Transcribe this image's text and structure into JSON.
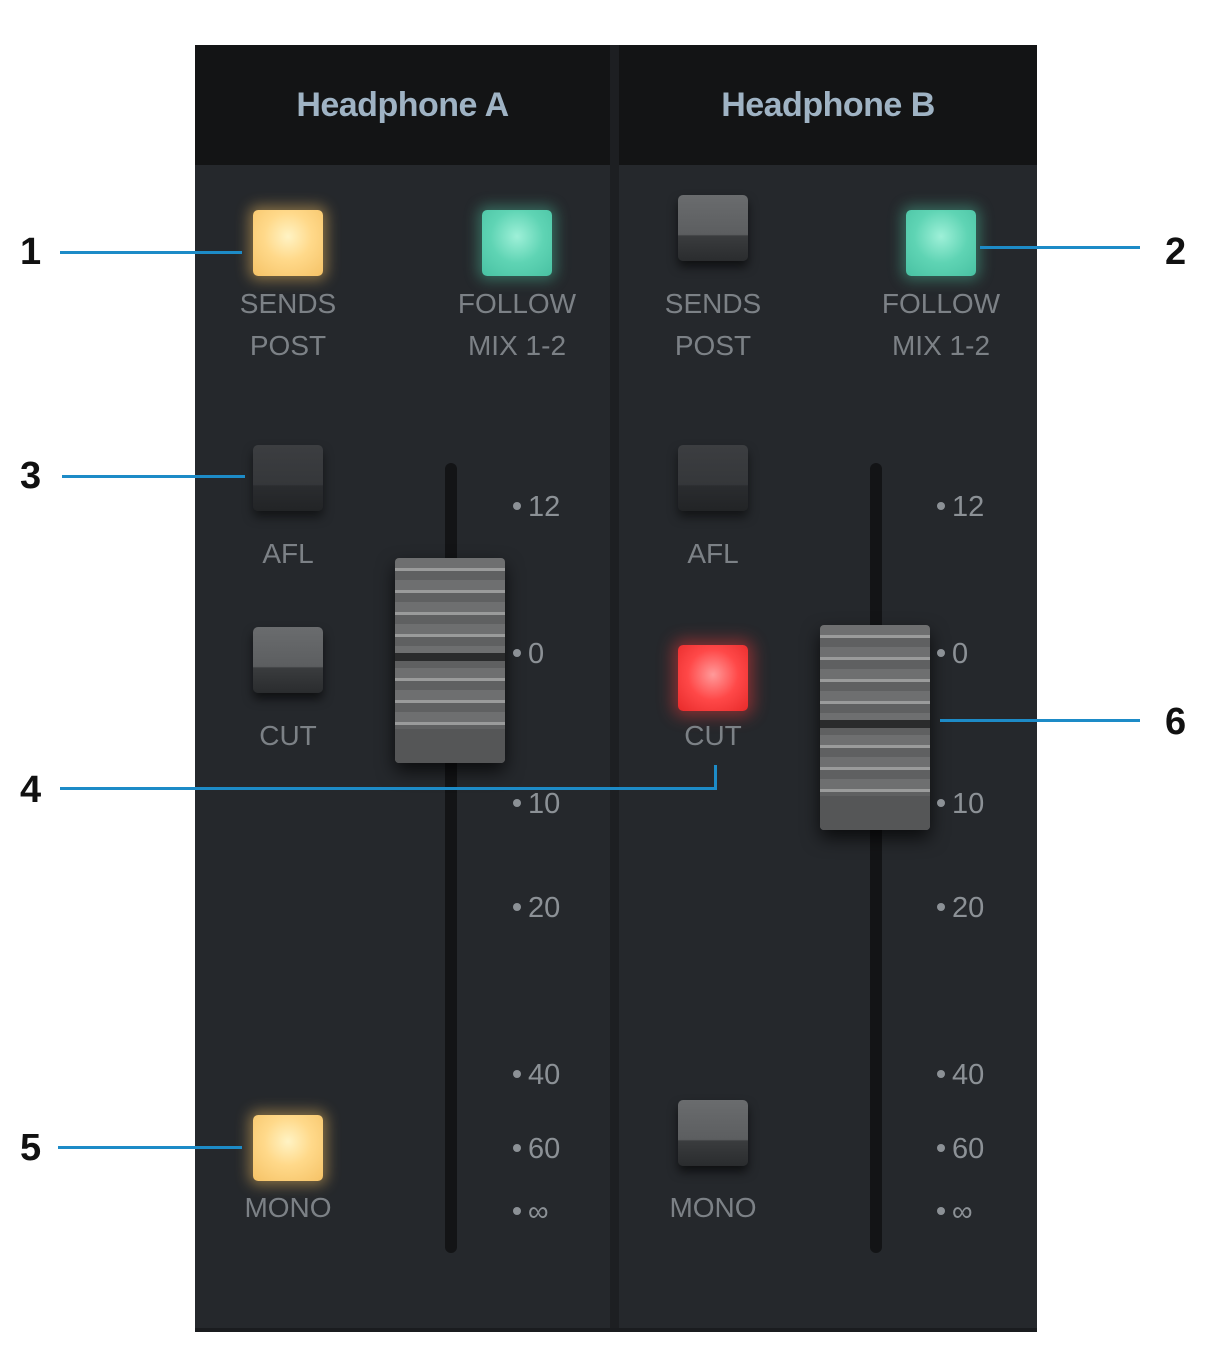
{
  "channels": [
    {
      "title": "Headphone A",
      "sends_post": {
        "label": "SENDS\nPOST",
        "state": "on",
        "color": "#ffd98a"
      },
      "follow_mix": {
        "label": "FOLLOW\nMIX 1-2",
        "state": "on",
        "color": "#5fd4b4"
      },
      "afl": {
        "label": "AFL",
        "state": "off"
      },
      "cut": {
        "label": "CUT",
        "state": "off"
      },
      "mono": {
        "label": "MONO",
        "state": "on",
        "color": "#ffd98a"
      },
      "fader_position_db": "-2"
    },
    {
      "title": "Headphone B",
      "sends_post": {
        "label": "SENDS\nPOST",
        "state": "off"
      },
      "follow_mix": {
        "label": "FOLLOW\nMIX 1-2",
        "state": "on",
        "color": "#5fd4b4"
      },
      "afl": {
        "label": "AFL",
        "state": "off"
      },
      "cut": {
        "label": "CUT",
        "state": "on",
        "color": "#ff4848"
      },
      "mono": {
        "label": "MONO",
        "state": "off"
      },
      "fader_position_db": "-5"
    }
  ],
  "scale": [
    "12",
    "0",
    "10",
    "20",
    "40",
    "60",
    "∞"
  ],
  "callouts": [
    "1",
    "2",
    "3",
    "4",
    "5",
    "6"
  ],
  "colors": {
    "callout_line": "#1d8bc7",
    "panel": "#25282c",
    "header": "#131415",
    "header_text": "#9fb3c4"
  }
}
